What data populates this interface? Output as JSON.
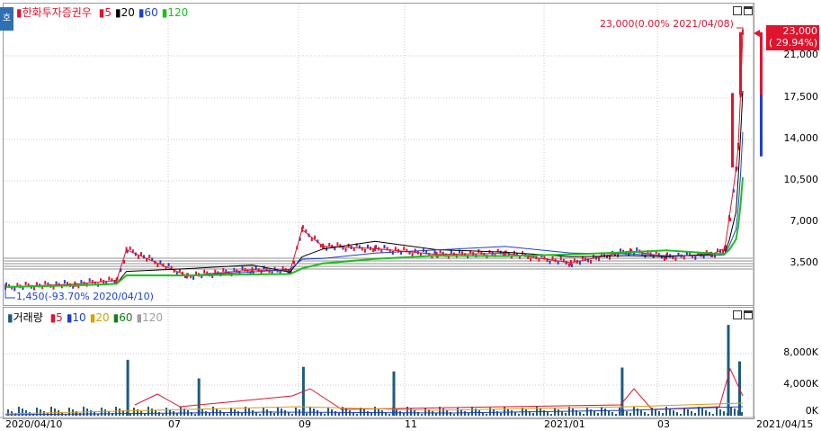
{
  "price_panel": {
    "zoom_label": "호",
    "stock_name": "한화투자증권우",
    "ma_legend": [
      {
        "label": "5",
        "color": "#e0142d"
      },
      {
        "label": "20",
        "color": "#000000"
      },
      {
        "label": "60",
        "color": "#1c3fd6"
      },
      {
        "label": "120",
        "color": "#19c219"
      }
    ],
    "high_annotation": "23,000(0.00% 2021/04/08)",
    "low_annotation": "1,450(-93.70% 2020/04/10)",
    "current_price": "23,000",
    "current_change": "( 29.94%)",
    "y_ticks": [
      "21,000",
      "17,500",
      "14,000",
      "10,500",
      "7,000",
      "3,500"
    ]
  },
  "volume_panel": {
    "title": "거래량",
    "ma_legend": [
      {
        "label": "5",
        "color": "#e0142d"
      },
      {
        "label": "10",
        "color": "#1c3fd6"
      },
      {
        "label": "20",
        "color": "#d8a000"
      },
      {
        "label": "60",
        "color": "#128012"
      },
      {
        "label": "120",
        "color": "#a0a0a0"
      }
    ],
    "y_ticks": [
      "8,000K",
      "4,000K",
      "0K"
    ]
  },
  "x_axis": {
    "labels": [
      "2020/04/10",
      "07",
      "09",
      "11",
      "2021/01",
      "03",
      "2021/04/15"
    ]
  },
  "colors": {
    "up": "#e0142d",
    "down": "#1c3fd6",
    "ma5": "#e0142d",
    "ma20": "#000000",
    "ma60": "#1c3fd6",
    "ma120": "#19c219",
    "volume": "#1f5a80"
  },
  "chart_data": {
    "type": "line",
    "title": "한화투자증권우",
    "x": [
      "2020/04/10",
      "2020/05/15",
      "2020/06/05",
      "2020/06/10",
      "2020/07/10",
      "2020/08/10",
      "2020/08/28",
      "2020/09/03",
      "2020/09/15",
      "2020/10/15",
      "2020/11/15",
      "2020/12/15",
      "2021/01/15",
      "2021/02/15",
      "2021/03/05",
      "2021/03/25",
      "2021/03/31",
      "2021/04/02",
      "2021/04/05",
      "2021/04/06",
      "2021/04/07",
      "2021/04/08"
    ],
    "series": [
      {
        "name": "price",
        "values": [
          1450,
          1700,
          2000,
          4600,
          2400,
          2900,
          2800,
          6300,
          4900,
          4700,
          4200,
          4300,
          3500,
          4500,
          4000,
          4200,
          4700,
          7300,
          11400,
          13400,
          17700,
          23000
        ]
      }
    ],
    "volume_series": {
      "name": "거래량",
      "x": [
        "2020/05/15",
        "2020/06/10",
        "2020/07/15",
        "2020/09/03",
        "2020/10/25",
        "2021/02/10",
        "2021/04/01",
        "2021/04/06"
      ],
      "values": [
        400000,
        7200000,
        4800000,
        6300000,
        5700000,
        6200000,
        11700000,
        7000000
      ]
    },
    "ma_periods": [
      5,
      20,
      60,
      120
    ],
    "ylim": [
      0,
      24500
    ],
    "volume_ylim": [
      0,
      12000000
    ]
  }
}
